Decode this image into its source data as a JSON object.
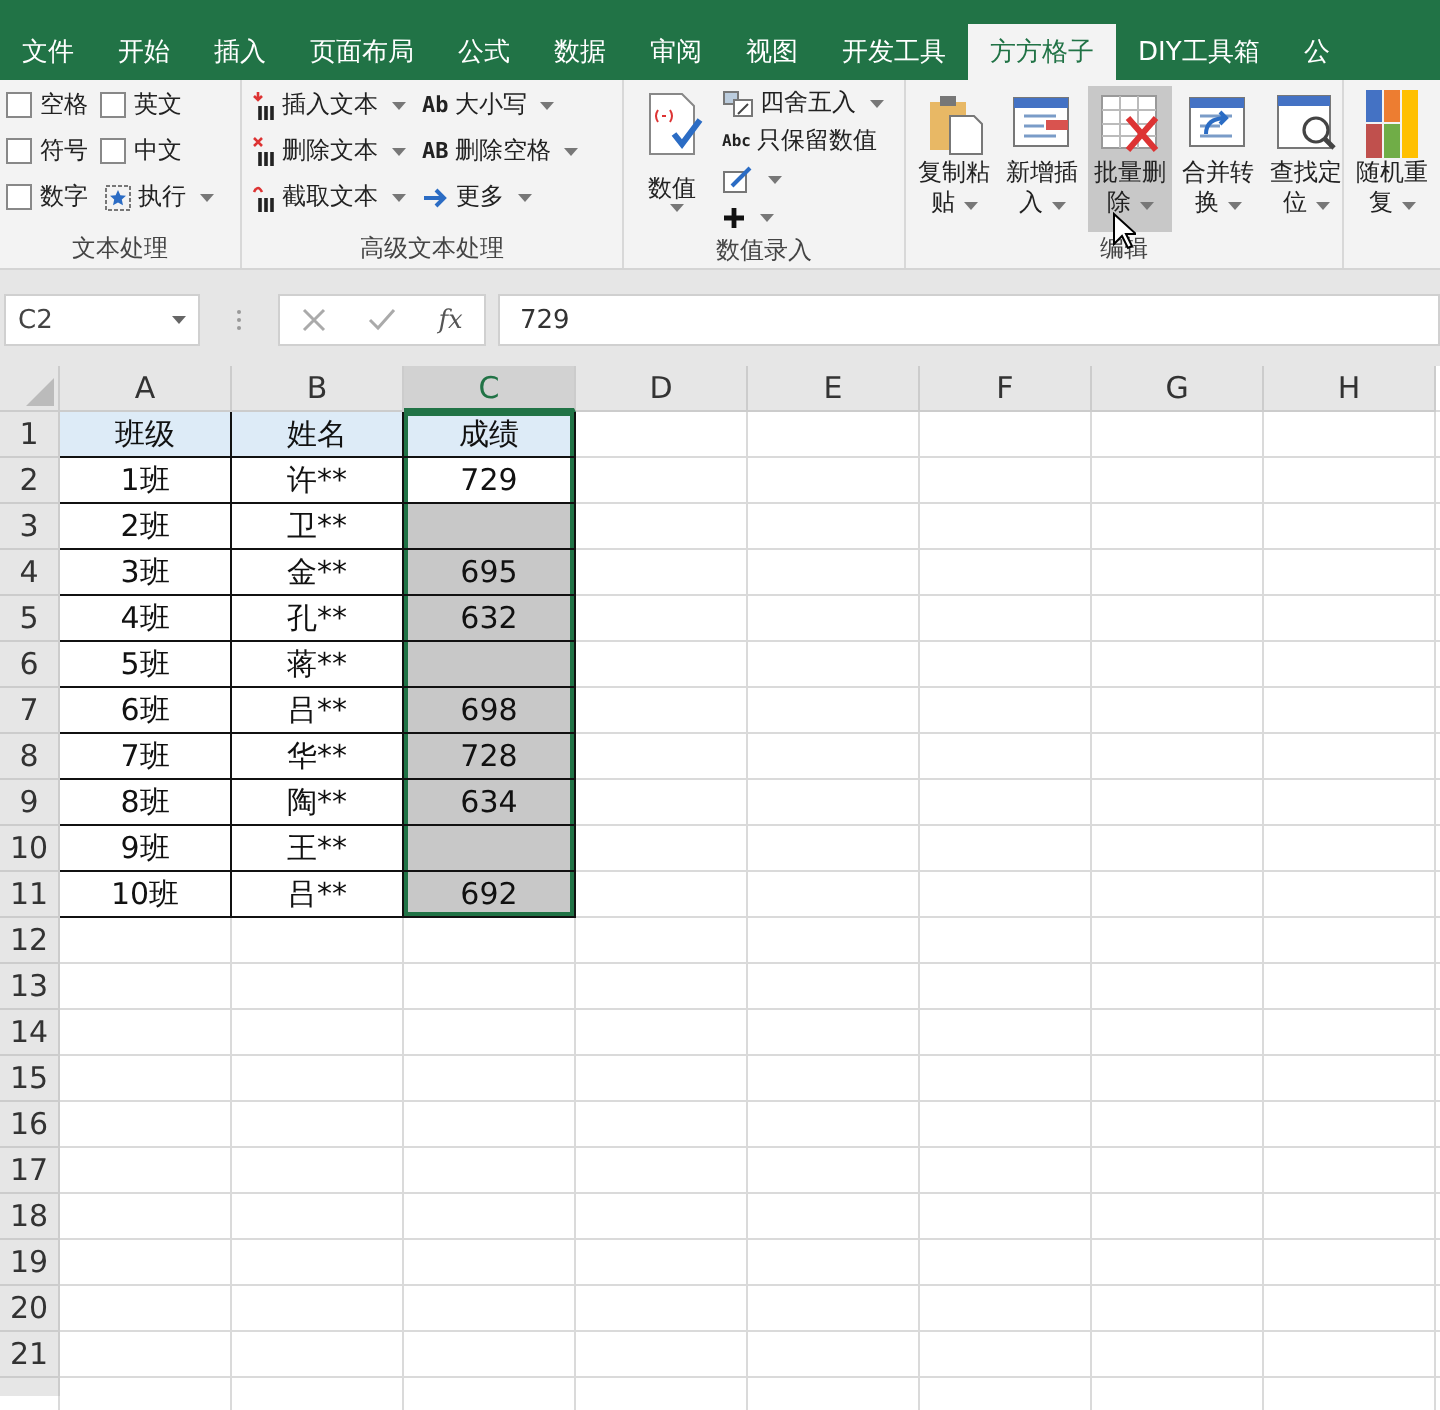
{
  "tabs": [
    {
      "label": "文件",
      "selected": false
    },
    {
      "label": "开始",
      "selected": false
    },
    {
      "label": "插入",
      "selected": false
    },
    {
      "label": "页面布局",
      "selected": false
    },
    {
      "label": "公式",
      "selected": false
    },
    {
      "label": "数据",
      "selected": false
    },
    {
      "label": "审阅",
      "selected": false
    },
    {
      "label": "视图",
      "selected": false
    },
    {
      "label": "开发工具",
      "selected": false
    },
    {
      "label": "方方格子",
      "selected": true
    },
    {
      "label": "DIY工具箱",
      "selected": false
    },
    {
      "label": "公",
      "selected": false
    }
  ],
  "ribbon": {
    "groups": [
      {
        "kind": "checks",
        "label": "文本处理",
        "checks": [
          {
            "label": "空格",
            "checked": false
          },
          {
            "label": "英文",
            "checked": false
          },
          {
            "label": "符号",
            "checked": false
          },
          {
            "label": "中文",
            "checked": false
          },
          {
            "label": "数字",
            "checked": false
          }
        ],
        "execute": {
          "label": "执行",
          "dropdown": true
        }
      },
      {
        "kind": "tools",
        "label": "高级文本处理",
        "items": [
          {
            "label": "插入文本",
            "dropdown": true
          },
          {
            "label": "删除文本",
            "dropdown": true
          },
          {
            "label": "截取文本",
            "dropdown": true
          },
          {
            "label": "大小写",
            "icon_text": "Ab",
            "dropdown": true
          },
          {
            "label": "删除空格",
            "icon_text": "AB",
            "dropdown": true
          },
          {
            "label": "更多",
            "dropdown": true
          }
        ]
      },
      {
        "kind": "entry",
        "label": "数值录入",
        "big": {
          "label": "数值",
          "dropdown": true
        },
        "items": [
          {
            "label": "四舍五入",
            "dropdown": true
          },
          {
            "label": "只保留数值",
            "icon_text": "Abc",
            "dropdown": false
          },
          {
            "dropdown": true
          },
          {
            "dropdown": true
          }
        ]
      },
      {
        "kind": "big",
        "label": "编辑",
        "items": [
          {
            "label": "复制粘贴",
            "dropdown": true,
            "hovered": false
          },
          {
            "label": "新增插入",
            "dropdown": true,
            "hovered": false
          },
          {
            "label": "批量删除",
            "dropdown": true,
            "hovered": true
          },
          {
            "label": "合并转换",
            "dropdown": true,
            "hovered": false
          },
          {
            "label": "查找定位",
            "dropdown": true,
            "hovered": false
          }
        ]
      },
      {
        "kind": "big",
        "items": [
          {
            "label": "随机重复",
            "dropdown": true,
            "hovered": false
          }
        ]
      }
    ]
  },
  "formula_bar": {
    "name_box": "C2",
    "function_label": "fx",
    "formula": "729"
  },
  "sheet": {
    "columns": [
      {
        "label": "A",
        "selected": false
      },
      {
        "label": "B",
        "selected": false
      },
      {
        "label": "C",
        "selected": true
      },
      {
        "label": "D",
        "selected": false
      },
      {
        "label": "E",
        "selected": false
      },
      {
        "label": "F",
        "selected": false
      },
      {
        "label": "G",
        "selected": false
      },
      {
        "label": "H",
        "selected": false
      }
    ],
    "rows": [
      {
        "number": "1",
        "kind": "heading",
        "class": "班级",
        "name": "姓名",
        "score": "成绩",
        "score_selected": true,
        "score_shaded": false
      },
      {
        "number": "2",
        "kind": "data",
        "class": "1班",
        "name": "许**",
        "score": "729",
        "score_selected": true,
        "score_shaded": false
      },
      {
        "number": "3",
        "kind": "data",
        "class": "2班",
        "name": "卫**",
        "score_selected": true,
        "score_shaded": true
      },
      {
        "number": "4",
        "kind": "data",
        "class": "3班",
        "name": "金**",
        "score": "695",
        "score_selected": true,
        "score_shaded": true
      },
      {
        "number": "5",
        "kind": "data",
        "class": "4班",
        "name": "孔**",
        "score": "632",
        "score_selected": true,
        "score_shaded": true
      },
      {
        "number": "6",
        "kind": "data",
        "class": "5班",
        "name": "蒋**",
        "score_selected": true,
        "score_shaded": true
      },
      {
        "number": "7",
        "kind": "data",
        "class": "6班",
        "name": "吕**",
        "score": "698",
        "score_selected": true,
        "score_shaded": true
      },
      {
        "number": "8",
        "kind": "data",
        "class": "7班",
        "name": "华**",
        "score": "728",
        "score_selected": true,
        "score_shaded": true
      },
      {
        "number": "9",
        "kind": "data",
        "class": "8班",
        "name": "陶**",
        "score": "634",
        "score_selected": true,
        "score_shaded": true
      },
      {
        "number": "10",
        "kind": "data",
        "class": "9班",
        "name": "王**",
        "score_selected": true,
        "score_shaded": true
      },
      {
        "number": "11",
        "kind": "data",
        "class": "10班",
        "name": "吕**",
        "score": "692",
        "score_selected": true,
        "score_shaded": true
      },
      {
        "number": "12",
        "kind": "empty"
      },
      {
        "number": "13",
        "kind": "empty"
      },
      {
        "number": "14",
        "kind": "empty"
      },
      {
        "number": "15",
        "kind": "empty"
      },
      {
        "number": "16",
        "kind": "empty"
      },
      {
        "number": "17",
        "kind": "empty"
      },
      {
        "number": "18",
        "kind": "empty"
      },
      {
        "number": "19",
        "kind": "empty"
      },
      {
        "number": "20",
        "kind": "empty"
      },
      {
        "number": "21",
        "kind": "empty"
      }
    ]
  }
}
